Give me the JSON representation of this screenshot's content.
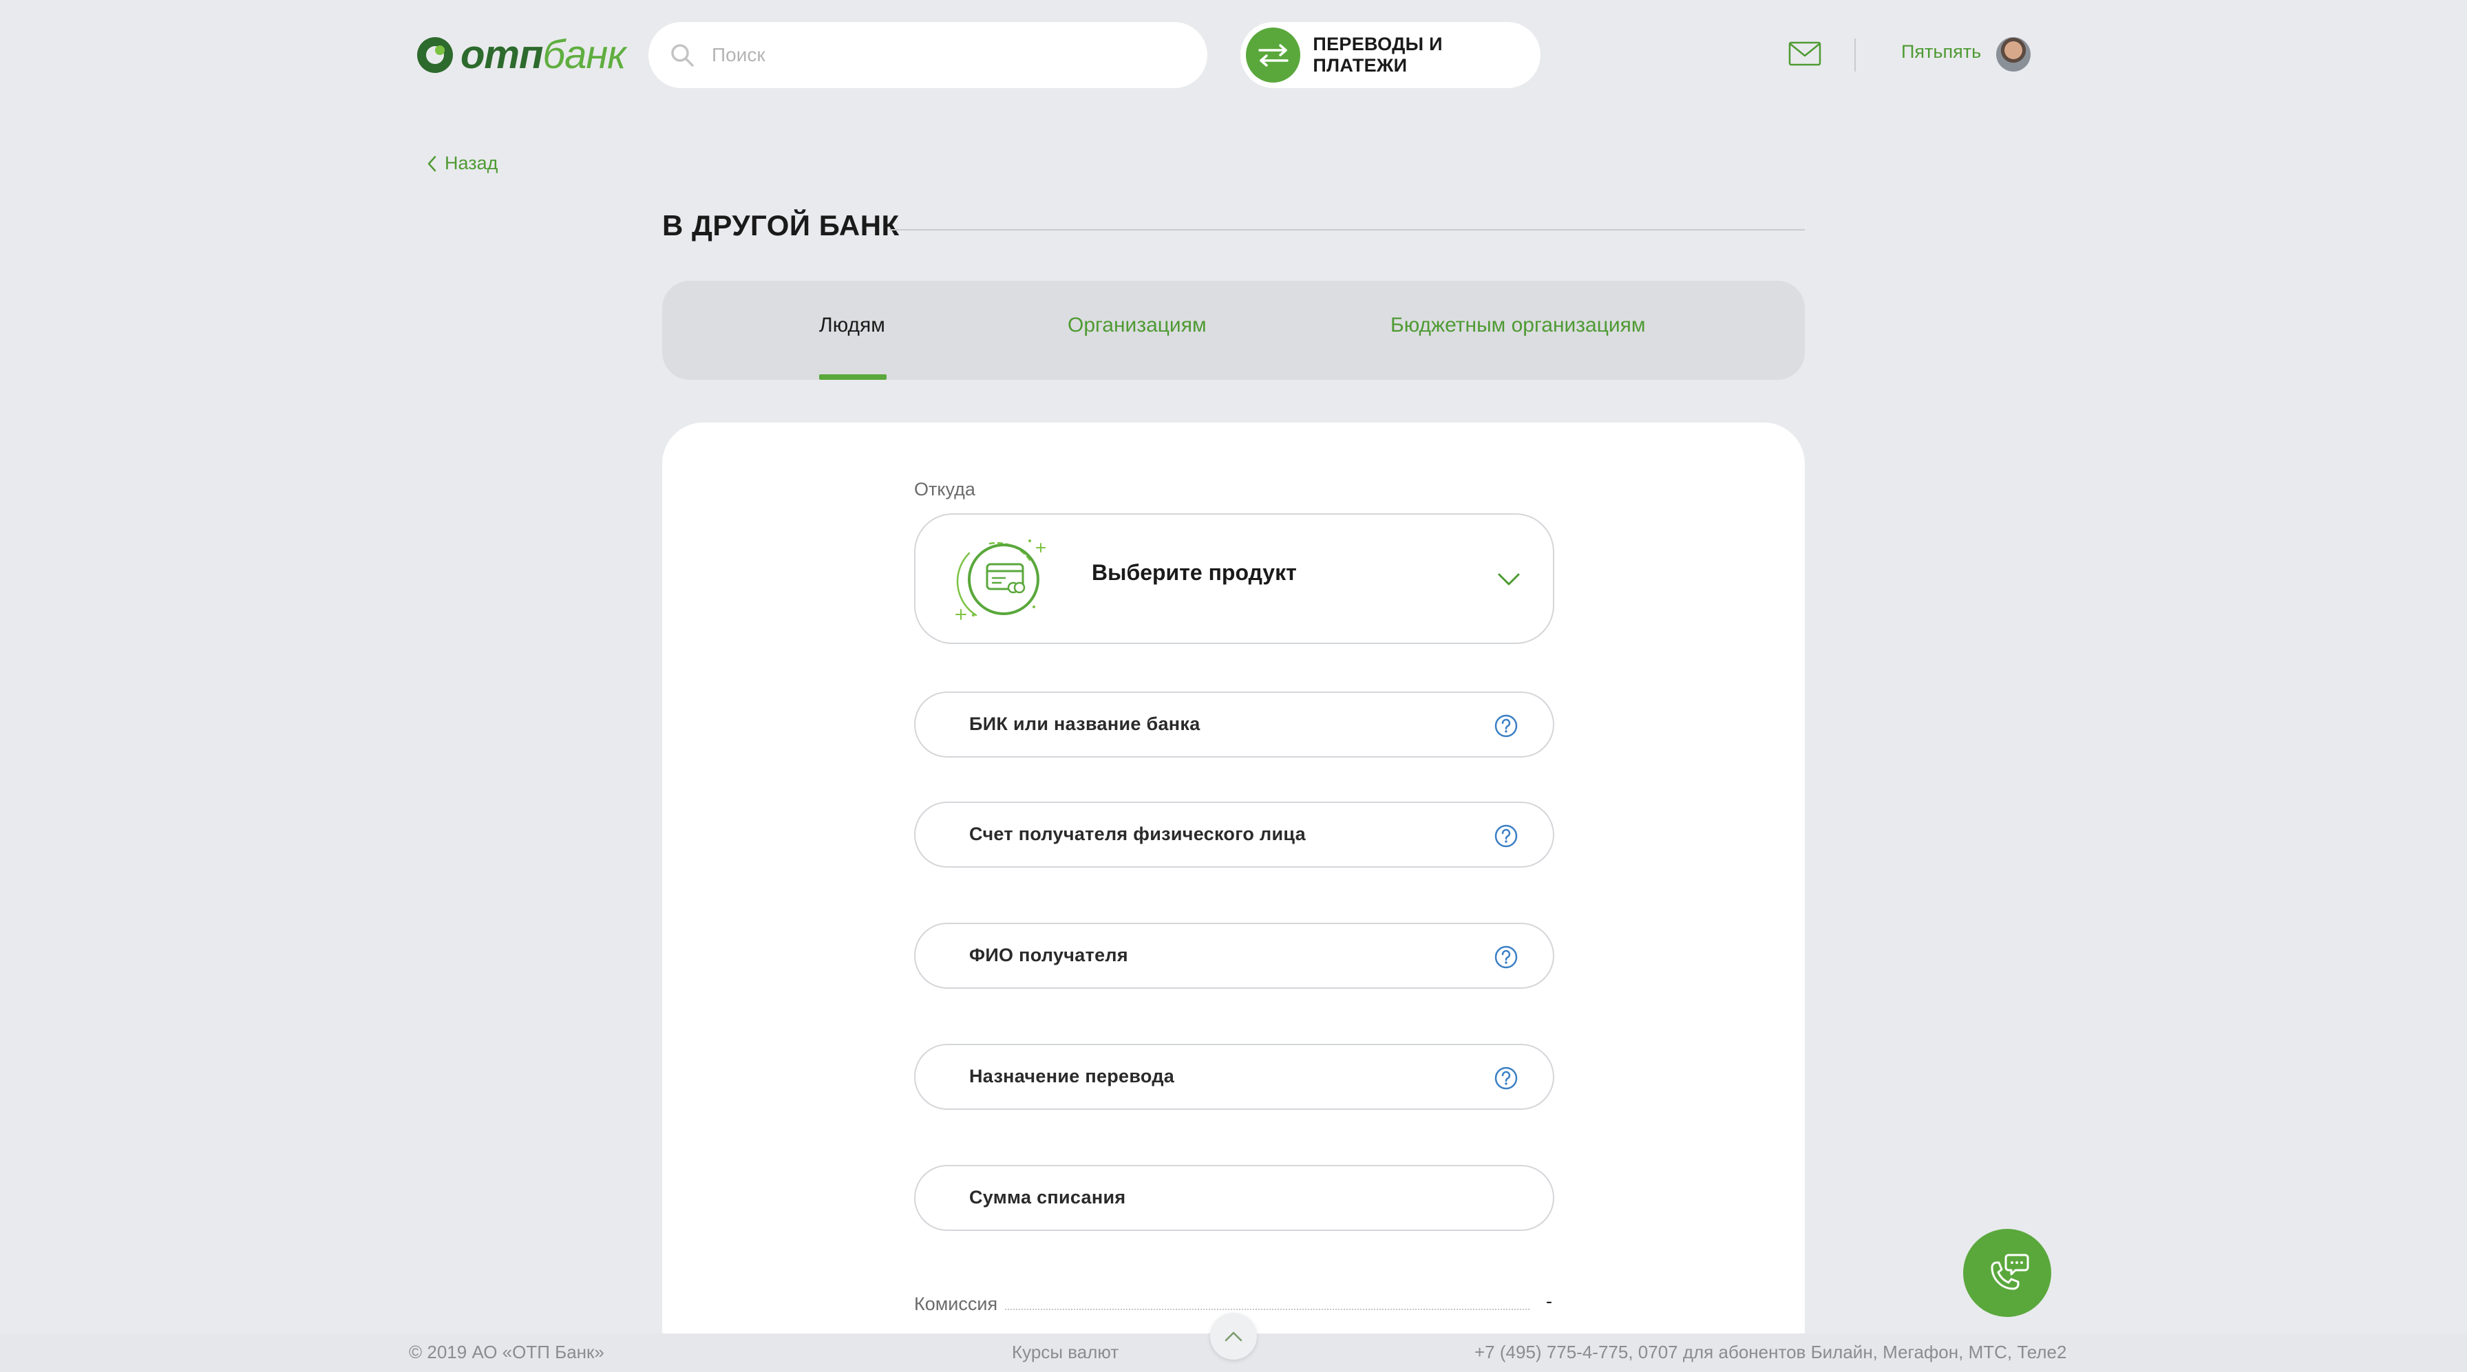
{
  "header": {
    "logo": {
      "otp": "отп",
      "bank": "банк"
    },
    "search": {
      "placeholder": "Поиск"
    },
    "transfers_button": "ПЕРЕВОДЫ И ПЛАТЕЖИ",
    "username": "Пятьпять"
  },
  "back": {
    "label": "Назад"
  },
  "page_title": "В ДРУГОЙ БАНК",
  "tabs": [
    {
      "label": "Людям",
      "active": true
    },
    {
      "label": "Организациям",
      "active": false
    },
    {
      "label": "Бюджетным организациям",
      "active": false
    }
  ],
  "form": {
    "from_label": "Откуда",
    "product_select": "Выберите продукт",
    "fields": [
      {
        "label": "БИК или название банка",
        "help": true
      },
      {
        "label": "Счет получателя физического лица",
        "help": true
      },
      {
        "label": "ФИО получателя",
        "help": true
      },
      {
        "label": "Назначение перевода",
        "help": true
      },
      {
        "label": "Сумма списания",
        "help": false
      }
    ],
    "commission_label": "Комиссия",
    "commission_value": "-"
  },
  "footer": {
    "copyright": "© 2019 АО «ОТП Банк»",
    "rates": "Курсы валют",
    "phones": "+7 (495) 775-4-775,  0707 для абонентов Билайн, Мегафон, МТС, Теле2"
  },
  "icons": {
    "search": "search-icon",
    "transfers": "arrows-swap-icon",
    "mail": "mail-icon",
    "back": "chevron-left-icon",
    "product": "card-illustration-icon",
    "dropdown": "chevron-down-icon",
    "help": "question-circle-icon",
    "scroll_top": "chevron-up-icon",
    "call": "phone-chat-icon"
  },
  "colors": {
    "brand_green": "#5aa83c",
    "link_green": "#4e9a33",
    "background": "#e9eaed",
    "help_blue": "#3b7fc4"
  }
}
